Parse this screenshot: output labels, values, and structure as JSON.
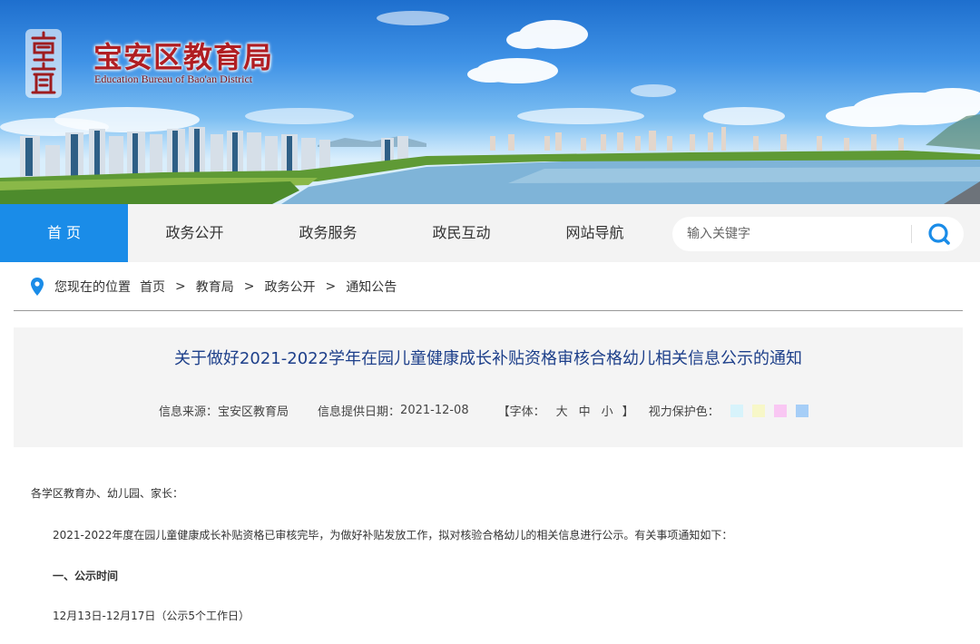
{
  "header": {
    "site_title": "宝安区教育局",
    "site_subtitle": "Education Bureau of Bao'an District"
  },
  "nav": {
    "items": [
      {
        "label": "首 页"
      },
      {
        "label": "政务公开"
      },
      {
        "label": "政务服务"
      },
      {
        "label": "政民互动"
      },
      {
        "label": "网站导航"
      }
    ],
    "search": {
      "placeholder": "输入关键字"
    }
  },
  "breadcrumb": {
    "prefix": "您现在的位置",
    "items": [
      "首页",
      "教育局",
      "政务公开",
      "通知公告"
    ],
    "separator": ">"
  },
  "article": {
    "title": "关于做好2021-2022学年在园儿童健康成长补贴资格审核合格幼儿相关信息公示的通知",
    "source_label": "信息来源：",
    "source": "宝安区教育局",
    "date_label": "信息提供日期：",
    "date": "2021-12-08",
    "font_label": "【字体：",
    "font_sizes": [
      "大",
      "中",
      "小"
    ],
    "font_close": "】",
    "eye_label": "视力保护色：",
    "eye_colors": [
      "#d7f3fb",
      "#f7f7c8",
      "#f9c7f3",
      "#a6cef7"
    ]
  },
  "body": {
    "greeting": "各学区教育办、幼儿园、家长：",
    "intro": "2021-2022年度在园儿童健康成长补贴资格已审核完毕，为做好补贴发放工作，拟对核验合格幼儿的相关信息进行公示。有关事项通知如下：",
    "section1_title": "一、公示时间",
    "section1_text": "12月13日-12月17日（公示5个工作日）"
  },
  "colors": {
    "accent_blue": "#1a8ce8",
    "title_red": "#b01e22",
    "article_title": "#1d3f8a"
  }
}
